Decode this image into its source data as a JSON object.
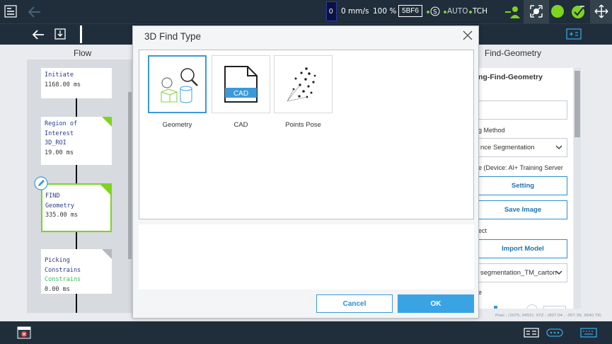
{
  "status_bar": {
    "counter": "0",
    "speed": "0 mm/s",
    "percent": "100 %",
    "code": "5BF6",
    "mode": "AUTO",
    "control": "TCH"
  },
  "flow": {
    "title": "Flow",
    "nodes": [
      {
        "line1": "Initiate",
        "line2": "1168.00 ms",
        "line3": ""
      },
      {
        "line1": "Region of Interest",
        "line2": "3D_ROI",
        "line3": "19.00 ms"
      },
      {
        "line1": "FIND",
        "line2": "Geometry",
        "line3": "335.00 ms"
      },
      {
        "line1": "Picking Constrains",
        "line2": "Constrains",
        "line3": "0.00 ms"
      }
    ]
  },
  "right_panel": {
    "title": "Find-Geometry",
    "heading": "ng-Find-Geometry",
    "method_label": "g Method",
    "method_value": "nce Segmentation",
    "device_label": "e (Device: AI+ Training Server",
    "setting_button": "Setting",
    "save_image_button": "Save Image",
    "object_label": "ect",
    "import_model_button": "Import Model",
    "model_value": "segmentation_TM_carton",
    "extra_label": "e"
  },
  "coords_readout": "Pixel : (1075, 0455); XYZ : (807.04 , -307.39, 3640.79)",
  "dialog": {
    "title": "3D Find Type",
    "options": [
      {
        "label": "Geometry",
        "icon": "geometry-shapes-icon",
        "selected": true
      },
      {
        "label": "CAD",
        "icon": "cad-file-icon",
        "selected": false,
        "badge": "CAD"
      },
      {
        "label": "Points Pose",
        "icon": "points-cloud-icon",
        "selected": false
      }
    ],
    "cancel_label": "Cancel",
    "ok_label": "OK"
  },
  "colors": {
    "bar_bg": "#1f2e3a",
    "accent": "#3aa3e3",
    "green": "#7ed321",
    "selected_border": "#3a9ad9"
  }
}
